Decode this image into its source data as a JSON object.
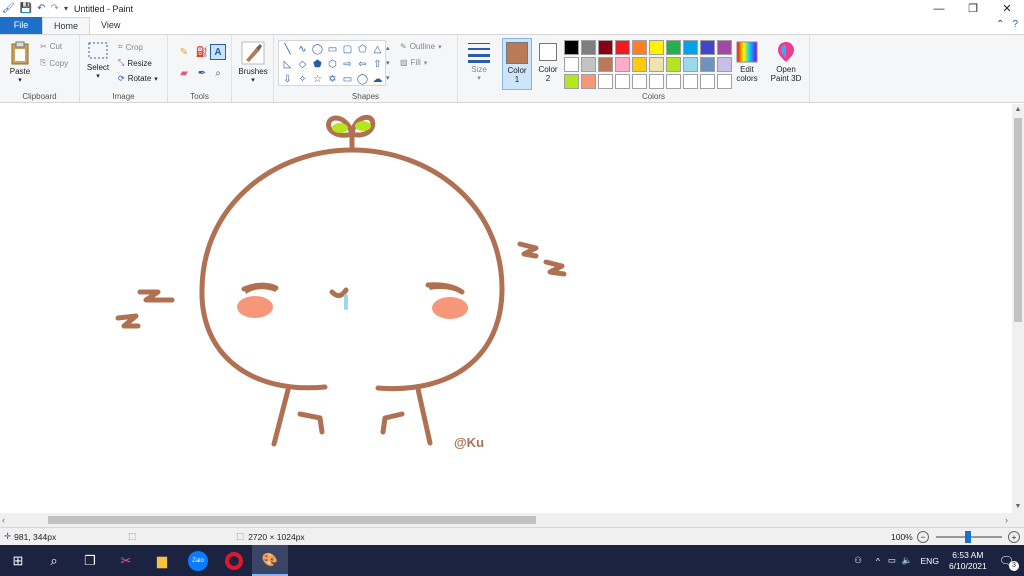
{
  "window": {
    "title": "Untitled - Paint",
    "minimize": "—",
    "restore": "❐",
    "close": "✕"
  },
  "tabs": {
    "file": "File",
    "home": "Home",
    "view": "View"
  },
  "ribbon": {
    "clipboard": {
      "label": "Clipboard",
      "paste": "Paste",
      "cut": "Cut",
      "copy": "Copy"
    },
    "image": {
      "label": "Image",
      "select": "Select",
      "crop": "Crop",
      "resize": "Resize",
      "rotate": "Rotate"
    },
    "tools": {
      "label": "Tools"
    },
    "brushes": {
      "label": "Brushes"
    },
    "shapes": {
      "label": "Shapes",
      "outline": "Outline",
      "fill": "Fill"
    },
    "size": {
      "label": "Size"
    },
    "colors": {
      "label": "Colors",
      "color1": "Color",
      "color1_num": "1",
      "color2": "Color",
      "color2_num": "2",
      "color1_value": "#b97a57",
      "color2_value": "#ffffff",
      "edit": "Edit",
      "edit2": "colors",
      "palette": [
        "#000000",
        "#7f7f7f",
        "#880015",
        "#ed1c24",
        "#ff7f27",
        "#fff200",
        "#22b14c",
        "#00a2e8",
        "#3f48cc",
        "#a349a4",
        "#ffffff",
        "#c3c3c3",
        "#b97a57",
        "#ffaec9",
        "#ffc90e",
        "#efe4b0",
        "#b5e61d",
        "#99d9ea",
        "#7092be",
        "#c8bfe7",
        "#b5e61d",
        "#f7977a",
        "#ffffff",
        "#ffffff",
        "#ffffff",
        "#ffffff",
        "#ffffff",
        "#ffffff",
        "#ffffff",
        "#ffffff"
      ]
    },
    "paint3d": {
      "line1": "Open",
      "line2": "Paint 3D"
    }
  },
  "drawing": {
    "stroke": "#b07052",
    "blush": "#f7977a",
    "leaf": "#b5e61d",
    "tear": "#99d9ea",
    "signature": "@Ku"
  },
  "status": {
    "cursor_pos": "981, 344px",
    "image_size": "2720 × 1024px",
    "zoom": "100%"
  },
  "taskbar": {
    "lang": "ENG",
    "time": "6:53 AM",
    "date": "6/10/2021",
    "notif_count": "3",
    "zalo": "Zalo"
  }
}
